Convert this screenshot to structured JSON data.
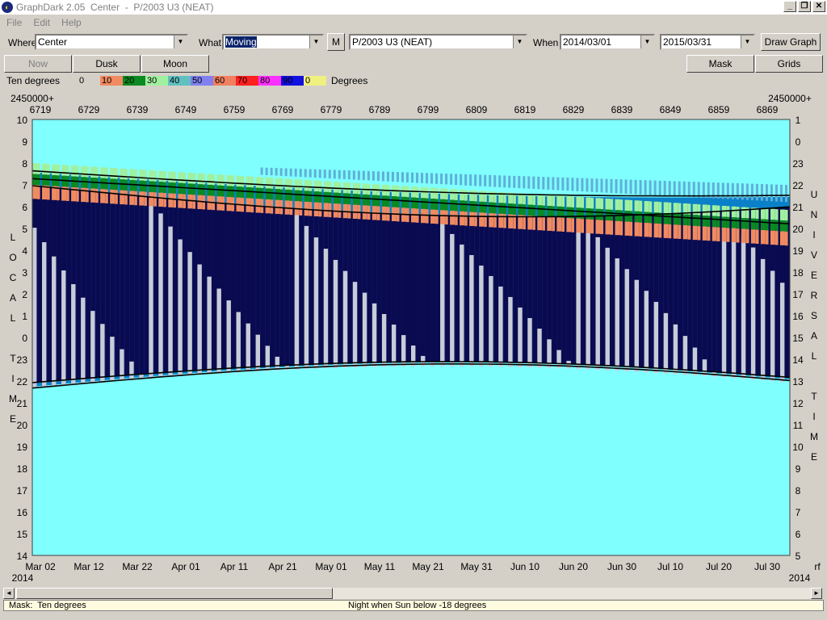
{
  "window": {
    "title": "GraphDark 2.05  Center  -  P/2003 U3 (NEAT)"
  },
  "menu": [
    "File",
    "Edit",
    "Help"
  ],
  "toolbar": {
    "where_label": "Where",
    "where_value": "Center",
    "what_label": "What",
    "what_value": "Moving",
    "m_button": "M",
    "object_value": "P/2003 U3 (NEAT)",
    "when_label": "When",
    "start_date": "2014/03/01",
    "end_date": "2015/03/31",
    "draw_button": "Draw Graph"
  },
  "toolbar2": {
    "now": "Now",
    "dusk": "Dusk",
    "moon": "Moon",
    "mask": "Mask",
    "grids": "Grids"
  },
  "legend": {
    "title": "Ten degrees",
    "end": "Degrees",
    "cells": [
      {
        "label": "0",
        "color": "#d4d0c8"
      },
      {
        "label": "10",
        "color": "#f08a60"
      },
      {
        "label": "20",
        "color": "#0a8a20"
      },
      {
        "label": "30",
        "color": "#a0f0a0"
      },
      {
        "label": "40",
        "color": "#60c0c0"
      },
      {
        "label": "50",
        "color": "#8080f0"
      },
      {
        "label": "60",
        "color": "#f08060"
      },
      {
        "label": "70",
        "color": "#ff2020"
      },
      {
        "label": "80",
        "color": "#ff30ff"
      },
      {
        "label": "90",
        "color": "#1010e0"
      },
      {
        "label": "0",
        "color": "#f0f080"
      }
    ]
  },
  "chart_data": {
    "type": "heatmap",
    "top_prefix_left": "2450000+",
    "top_prefix_right": "2450000+",
    "jd_ticks": [
      "6719",
      "6729",
      "6739",
      "6749",
      "6759",
      "6769",
      "6779",
      "6789",
      "6799",
      "6809",
      "6819",
      "6829",
      "6839",
      "6849",
      "6859",
      "6869"
    ],
    "left_axis_ticks": [
      "10",
      "9",
      "8",
      "7",
      "6",
      "5",
      "4",
      "3",
      "2",
      "1",
      "0",
      "23",
      "22",
      "21",
      "20",
      "19",
      "18",
      "17",
      "16",
      "15",
      "14"
    ],
    "right_axis_ticks": [
      "1",
      "0",
      "23",
      "22",
      "21",
      "20",
      "19",
      "18",
      "17",
      "16",
      "15",
      "14",
      "13",
      "12",
      "11",
      "10",
      "9",
      "8",
      "7",
      "6",
      "5"
    ],
    "left_axis_title": [
      "L",
      "O",
      "C",
      "A",
      "L",
      "",
      "T",
      "I",
      "M",
      "E"
    ],
    "right_axis_title": [
      "U",
      "N",
      "I",
      "V",
      "E",
      "R",
      "S",
      "A",
      "L",
      "",
      "T",
      "I",
      "M",
      "E"
    ],
    "date_ticks": [
      "Mar 02",
      "Mar 12",
      "Mar 22",
      "Apr 01",
      "Apr 11",
      "Apr 21",
      "May 01",
      "May 11",
      "May 21",
      "May 31",
      "Jun 10",
      "Jun 20",
      "Jun 30",
      "Jul 10",
      "Jul 20",
      "Jul 30"
    ],
    "year_left": "2014",
    "year_right": "2014",
    "trailing_label": "rf",
    "colors": {
      "day": "#80ffff",
      "twilight": "#0a80c8",
      "night": "#0a0a50",
      "moonlit": "#c8ccd8",
      "alt10": "#f08a60",
      "alt20": "#0a8a20",
      "alt30": "#a0f0a0",
      "alt40": "#60b0d8"
    }
  },
  "scrollbar": {
    "left_arrow": "◄",
    "right_arrow": "►"
  },
  "status": {
    "left": "Mask:  Ten degrees",
    "middle": "Night when Sun below -18 degrees"
  }
}
